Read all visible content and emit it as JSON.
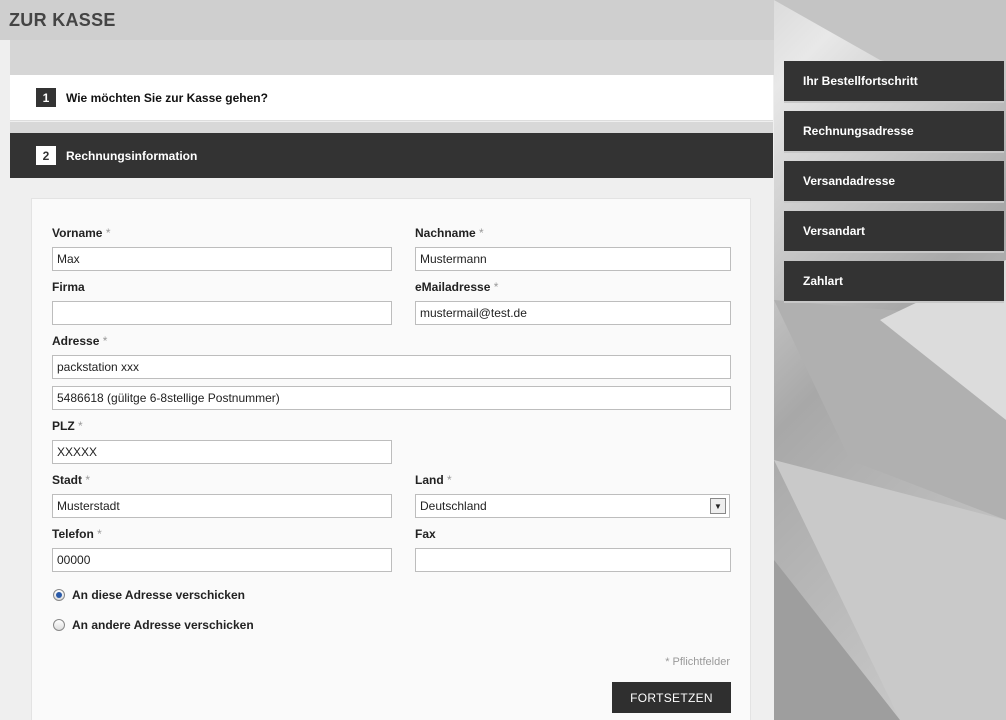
{
  "page": {
    "title": "ZUR KASSE"
  },
  "steps": [
    {
      "number": "1",
      "label": "Wie möchten Sie zur Kasse gehen?"
    },
    {
      "number": "2",
      "label": "Rechnungsinformation"
    }
  ],
  "form": {
    "firstname": {
      "label": "Vorname",
      "required": "*",
      "value": "Max"
    },
    "lastname": {
      "label": "Nachname",
      "required": "*",
      "value": "Mustermann"
    },
    "company": {
      "label": "Firma",
      "value": ""
    },
    "email": {
      "label": "eMailadresse",
      "required": "*",
      "value": "mustermail@test.de"
    },
    "address": {
      "label": "Adresse",
      "required": "*",
      "line1": "packstation xxx",
      "line2": "5486618 (gülitge 6-8stellige Postnummer)"
    },
    "zip": {
      "label": "PLZ",
      "required": "*",
      "value": "XXXXX"
    },
    "city": {
      "label": "Stadt",
      "required": "*",
      "value": "Musterstadt"
    },
    "country": {
      "label": "Land",
      "required": "*",
      "value": "Deutschland"
    },
    "phone": {
      "label": "Telefon",
      "required": "*",
      "value": "00000"
    },
    "fax": {
      "label": "Fax",
      "value": ""
    },
    "ship_options": [
      {
        "label": "An diese Adresse verschicken",
        "selected": true
      },
      {
        "label": "An andere Adresse verschicken",
        "selected": false
      }
    ],
    "required_hint": "* Pflichtfelder",
    "submit_label": "FORTSETZEN"
  },
  "sidebar": {
    "items": [
      {
        "label": "Ihr Bestellfortschritt"
      },
      {
        "label": "Rechnungsadresse"
      },
      {
        "label": "Versandadresse"
      },
      {
        "label": "Versandart"
      },
      {
        "label": "Zahlart"
      }
    ]
  },
  "colors": {
    "dark": "#333333",
    "radio_selected": "#2a5aa8"
  }
}
